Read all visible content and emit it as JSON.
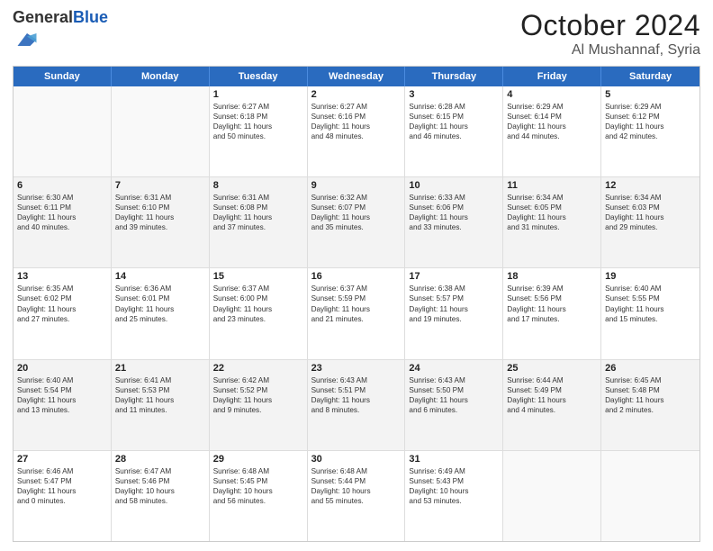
{
  "header": {
    "logo_general": "General",
    "logo_blue": "Blue",
    "month": "October 2024",
    "location": "Al Mushannaf, Syria"
  },
  "weekdays": [
    "Sunday",
    "Monday",
    "Tuesday",
    "Wednesday",
    "Thursday",
    "Friday",
    "Saturday"
  ],
  "rows": [
    [
      {
        "day": "",
        "lines": [],
        "empty": true
      },
      {
        "day": "",
        "lines": [],
        "empty": true
      },
      {
        "day": "1",
        "lines": [
          "Sunrise: 6:27 AM",
          "Sunset: 6:18 PM",
          "Daylight: 11 hours",
          "and 50 minutes."
        ]
      },
      {
        "day": "2",
        "lines": [
          "Sunrise: 6:27 AM",
          "Sunset: 6:16 PM",
          "Daylight: 11 hours",
          "and 48 minutes."
        ]
      },
      {
        "day": "3",
        "lines": [
          "Sunrise: 6:28 AM",
          "Sunset: 6:15 PM",
          "Daylight: 11 hours",
          "and 46 minutes."
        ]
      },
      {
        "day": "4",
        "lines": [
          "Sunrise: 6:29 AM",
          "Sunset: 6:14 PM",
          "Daylight: 11 hours",
          "and 44 minutes."
        ]
      },
      {
        "day": "5",
        "lines": [
          "Sunrise: 6:29 AM",
          "Sunset: 6:12 PM",
          "Daylight: 11 hours",
          "and 42 minutes."
        ]
      }
    ],
    [
      {
        "day": "6",
        "lines": [
          "Sunrise: 6:30 AM",
          "Sunset: 6:11 PM",
          "Daylight: 11 hours",
          "and 40 minutes."
        ]
      },
      {
        "day": "7",
        "lines": [
          "Sunrise: 6:31 AM",
          "Sunset: 6:10 PM",
          "Daylight: 11 hours",
          "and 39 minutes."
        ]
      },
      {
        "day": "8",
        "lines": [
          "Sunrise: 6:31 AM",
          "Sunset: 6:08 PM",
          "Daylight: 11 hours",
          "and 37 minutes."
        ]
      },
      {
        "day": "9",
        "lines": [
          "Sunrise: 6:32 AM",
          "Sunset: 6:07 PM",
          "Daylight: 11 hours",
          "and 35 minutes."
        ]
      },
      {
        "day": "10",
        "lines": [
          "Sunrise: 6:33 AM",
          "Sunset: 6:06 PM",
          "Daylight: 11 hours",
          "and 33 minutes."
        ]
      },
      {
        "day": "11",
        "lines": [
          "Sunrise: 6:34 AM",
          "Sunset: 6:05 PM",
          "Daylight: 11 hours",
          "and 31 minutes."
        ]
      },
      {
        "day": "12",
        "lines": [
          "Sunrise: 6:34 AM",
          "Sunset: 6:03 PM",
          "Daylight: 11 hours",
          "and 29 minutes."
        ]
      }
    ],
    [
      {
        "day": "13",
        "lines": [
          "Sunrise: 6:35 AM",
          "Sunset: 6:02 PM",
          "Daylight: 11 hours",
          "and 27 minutes."
        ]
      },
      {
        "day": "14",
        "lines": [
          "Sunrise: 6:36 AM",
          "Sunset: 6:01 PM",
          "Daylight: 11 hours",
          "and 25 minutes."
        ]
      },
      {
        "day": "15",
        "lines": [
          "Sunrise: 6:37 AM",
          "Sunset: 6:00 PM",
          "Daylight: 11 hours",
          "and 23 minutes."
        ]
      },
      {
        "day": "16",
        "lines": [
          "Sunrise: 6:37 AM",
          "Sunset: 5:59 PM",
          "Daylight: 11 hours",
          "and 21 minutes."
        ]
      },
      {
        "day": "17",
        "lines": [
          "Sunrise: 6:38 AM",
          "Sunset: 5:57 PM",
          "Daylight: 11 hours",
          "and 19 minutes."
        ]
      },
      {
        "day": "18",
        "lines": [
          "Sunrise: 6:39 AM",
          "Sunset: 5:56 PM",
          "Daylight: 11 hours",
          "and 17 minutes."
        ]
      },
      {
        "day": "19",
        "lines": [
          "Sunrise: 6:40 AM",
          "Sunset: 5:55 PM",
          "Daylight: 11 hours",
          "and 15 minutes."
        ]
      }
    ],
    [
      {
        "day": "20",
        "lines": [
          "Sunrise: 6:40 AM",
          "Sunset: 5:54 PM",
          "Daylight: 11 hours",
          "and 13 minutes."
        ]
      },
      {
        "day": "21",
        "lines": [
          "Sunrise: 6:41 AM",
          "Sunset: 5:53 PM",
          "Daylight: 11 hours",
          "and 11 minutes."
        ]
      },
      {
        "day": "22",
        "lines": [
          "Sunrise: 6:42 AM",
          "Sunset: 5:52 PM",
          "Daylight: 11 hours",
          "and 9 minutes."
        ]
      },
      {
        "day": "23",
        "lines": [
          "Sunrise: 6:43 AM",
          "Sunset: 5:51 PM",
          "Daylight: 11 hours",
          "and 8 minutes."
        ]
      },
      {
        "day": "24",
        "lines": [
          "Sunrise: 6:43 AM",
          "Sunset: 5:50 PM",
          "Daylight: 11 hours",
          "and 6 minutes."
        ]
      },
      {
        "day": "25",
        "lines": [
          "Sunrise: 6:44 AM",
          "Sunset: 5:49 PM",
          "Daylight: 11 hours",
          "and 4 minutes."
        ]
      },
      {
        "day": "26",
        "lines": [
          "Sunrise: 6:45 AM",
          "Sunset: 5:48 PM",
          "Daylight: 11 hours",
          "and 2 minutes."
        ]
      }
    ],
    [
      {
        "day": "27",
        "lines": [
          "Sunrise: 6:46 AM",
          "Sunset: 5:47 PM",
          "Daylight: 11 hours",
          "and 0 minutes."
        ]
      },
      {
        "day": "28",
        "lines": [
          "Sunrise: 6:47 AM",
          "Sunset: 5:46 PM",
          "Daylight: 10 hours",
          "and 58 minutes."
        ]
      },
      {
        "day": "29",
        "lines": [
          "Sunrise: 6:48 AM",
          "Sunset: 5:45 PM",
          "Daylight: 10 hours",
          "and 56 minutes."
        ]
      },
      {
        "day": "30",
        "lines": [
          "Sunrise: 6:48 AM",
          "Sunset: 5:44 PM",
          "Daylight: 10 hours",
          "and 55 minutes."
        ]
      },
      {
        "day": "31",
        "lines": [
          "Sunrise: 6:49 AM",
          "Sunset: 5:43 PM",
          "Daylight: 10 hours",
          "and 53 minutes."
        ]
      },
      {
        "day": "",
        "lines": [],
        "empty": true
      },
      {
        "day": "",
        "lines": [],
        "empty": true
      }
    ]
  ]
}
